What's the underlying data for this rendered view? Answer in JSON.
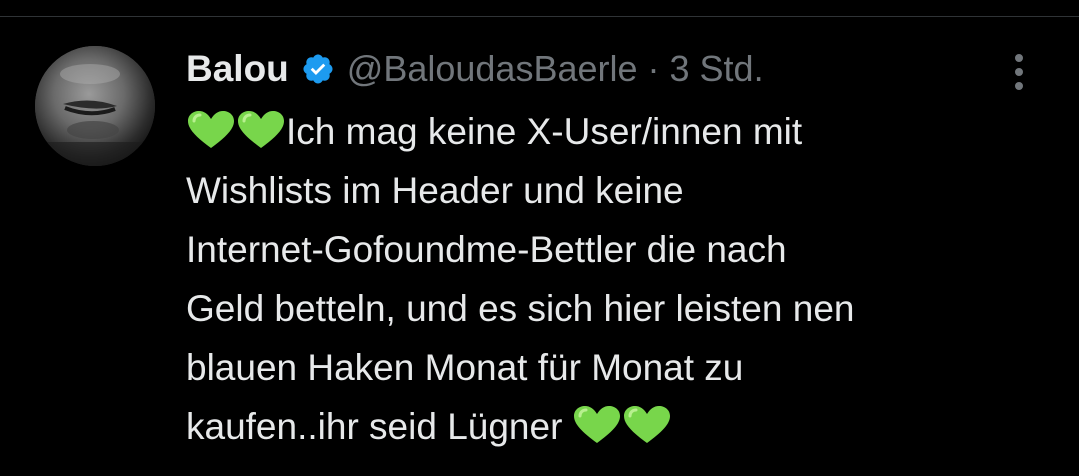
{
  "tweet": {
    "author_name": "Balou",
    "handle": "@BaloudasBaerle",
    "separator": "·",
    "time": "3 Std.",
    "verified": true,
    "lines": [
      "Ich mag keine X-User/innen mit",
      "Wishlists im Header und keine",
      "Internet-Gofoundme-Bettler die nach",
      "Geld betteln, und es sich hier leisten nen",
      "blauen Haken Monat für Monat zu",
      "kaufen..ihr seid Lügner"
    ],
    "leading_emoji": [
      "green-heart",
      "green-heart"
    ],
    "trailing_emoji": [
      "green-heart",
      "green-heart"
    ]
  },
  "icons": {
    "verified_badge": "verified-badge-icon",
    "more": "more-options-icon",
    "heart": "green-heart-icon"
  },
  "colors": {
    "background": "#000000",
    "text_primary": "#e7e9ea",
    "text_secondary": "#71767b",
    "verified_blue": "#1d9bf0",
    "heart_green": "#78d64b",
    "divider": "#2f3336"
  }
}
